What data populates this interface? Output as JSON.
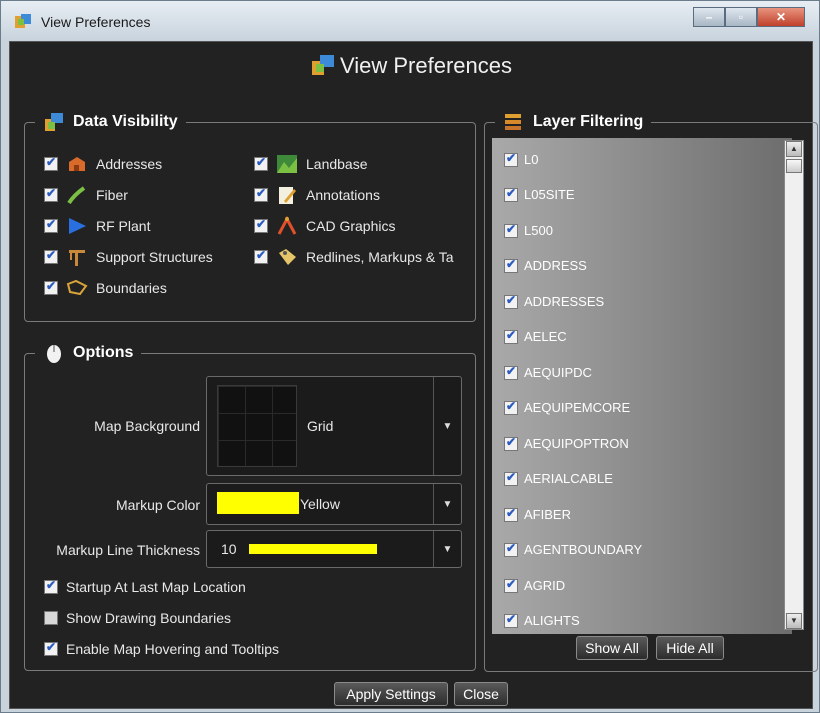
{
  "window": {
    "title": "View Preferences"
  },
  "header": {
    "title": "View Preferences"
  },
  "data_visibility": {
    "title": "Data Visibility",
    "items": [
      {
        "label": "Addresses",
        "checked": true,
        "icon": "addresses-icon"
      },
      {
        "label": "Fiber",
        "checked": true,
        "icon": "fiber-icon"
      },
      {
        "label": "RF Plant",
        "checked": true,
        "icon": "rf-plant-icon"
      },
      {
        "label": "Support Structures",
        "checked": true,
        "icon": "support-structures-icon"
      },
      {
        "label": "Boundaries",
        "checked": true,
        "icon": "boundaries-icon"
      },
      {
        "label": "Landbase",
        "checked": true,
        "icon": "landbase-icon"
      },
      {
        "label": "Annotations",
        "checked": true,
        "icon": "annotations-icon"
      },
      {
        "label": "CAD Graphics",
        "checked": true,
        "icon": "cad-graphics-icon"
      },
      {
        "label": "Redlines, Markups & Ta",
        "checked": true,
        "icon": "redlines-icon"
      }
    ]
  },
  "options": {
    "title": "Options",
    "map_background_label": "Map Background",
    "map_background_value": "Grid",
    "markup_color_label": "Markup Color",
    "markup_color_value": "Yellow",
    "markup_color_hex": "#ffff00",
    "line_thickness_label": "Markup Line Thickness",
    "line_thickness_value": "10",
    "checks": [
      {
        "label": "Startup At Last Map Location",
        "checked": true
      },
      {
        "label": "Show Drawing Boundaries",
        "checked": false
      },
      {
        "label": "Enable Map Hovering and Tooltips",
        "checked": true
      }
    ]
  },
  "layer_filtering": {
    "title": "Layer Filtering",
    "layers": [
      "L0",
      "L05SITE",
      "L500",
      "ADDRESS",
      "ADDRESSES",
      "AELEC",
      "AEQUIPDC",
      "AEQUIPEMCORE",
      "AEQUIPOPTRON",
      "AERIALCABLE",
      "AFIBER",
      "AGENTBOUNDARY",
      "AGRID",
      "ALIGHTS"
    ],
    "show_all": "Show All",
    "hide_all": "Hide All"
  },
  "footer": {
    "apply": "Apply Settings",
    "close": "Close"
  }
}
